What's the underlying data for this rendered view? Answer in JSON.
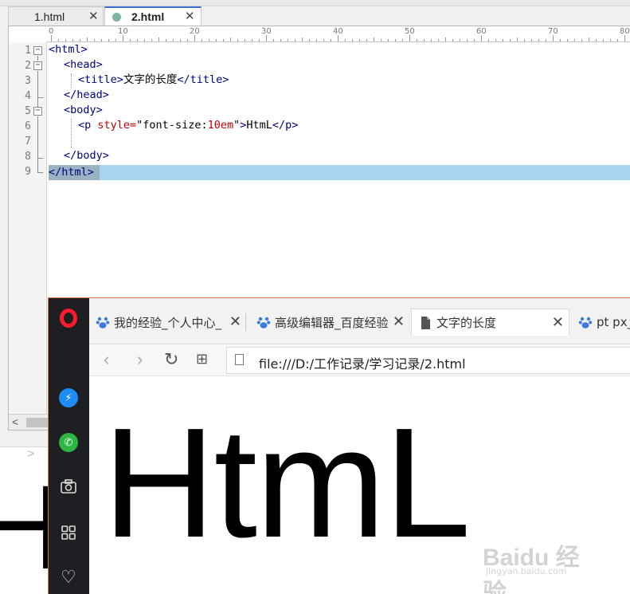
{
  "editor": {
    "tabs": [
      {
        "label": "1.html",
        "close": "✕"
      },
      {
        "label": "2.html",
        "close": "✕"
      }
    ],
    "ruler_labels": [
      "0",
      "10",
      "20",
      "30",
      "40",
      "50",
      "60",
      "70",
      "80"
    ],
    "line_numbers": [
      "1",
      "2",
      "3",
      "4",
      "5",
      "6",
      "7",
      "8",
      "9"
    ],
    "fold_markers": [
      "−",
      "−",
      "−"
    ],
    "code": {
      "l1": {
        "open": "<html>"
      },
      "l2": {
        "open": "<head>"
      },
      "l3": {
        "open": "<title>",
        "text": "文字的长度",
        "close": "</title>"
      },
      "l4": {
        "close": "</head>"
      },
      "l5": {
        "open": "<body>"
      },
      "l6": {
        "open": "<p ",
        "attr": "style=",
        "q1": "\"font-size:",
        "num": "10em",
        "q2": "\"",
        "gt": ">",
        "text": "HtmL",
        "close": "</p>"
      },
      "l8": {
        "close": "</body>"
      },
      "l9": {
        "close": "</html>"
      }
    },
    "scroll_left": "<"
  },
  "background": {
    "chevron": ">",
    "partial_text": "H"
  },
  "browser": {
    "tabs": [
      {
        "label": "我的经验_个人中心_",
        "close": "✕"
      },
      {
        "label": "高级编辑器_百度经验",
        "close": "✕"
      },
      {
        "label": "文字的长度",
        "close": "✕"
      },
      {
        "label": "pt px_"
      }
    ],
    "nav": {
      "back": "‹",
      "forward": "›",
      "reload": "↻",
      "grid": "⊞"
    },
    "address": "file:///D:/工作记录/学习记录/2.html",
    "content_text": "HtmL",
    "sidebar_heart": "♡"
  },
  "watermark": {
    "brand": "Baidu 经验",
    "site": "jingyan.baidu.com"
  },
  "colors": {
    "opera_red": "#ff1b2d",
    "messenger_blue": "#1d8df2",
    "whatsapp_green": "#2bb741",
    "line_highlight": "#a9d4ee"
  }
}
